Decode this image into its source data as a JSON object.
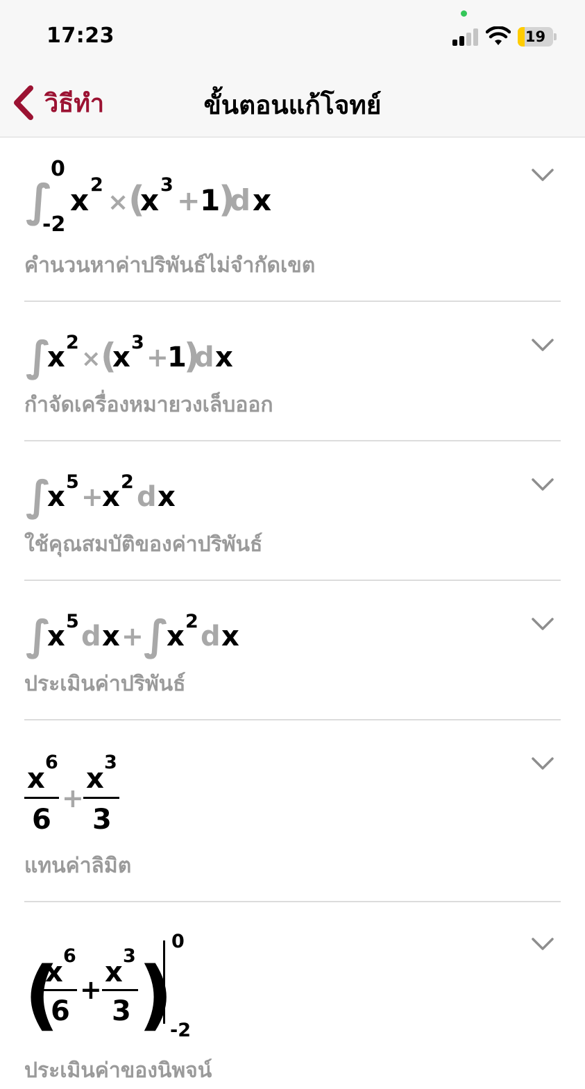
{
  "status_bar": {
    "time": "17:23",
    "battery": "19",
    "battery_level_percent": 19,
    "icons": [
      "signal-icon",
      "wifi-icon",
      "battery-icon"
    ]
  },
  "nav": {
    "back_label": "วิธีทำ",
    "title": "ขั้นตอนแก้โจทย์"
  },
  "colors": {
    "accent": "#9b1232",
    "muted_text": "#9a9a9a",
    "battery": "#ffcc00"
  },
  "steps": [
    {
      "expression": {
        "integral": "∫",
        "upper_limit": "0",
        "lower_limit": "-2",
        "x": "x",
        "exp2": "2",
        "times": "×",
        "open_paren": "(",
        "exp3": "3",
        "plus": "+",
        "one": "1",
        "close_paren": ")",
        "d": "d",
        "dx_var": "x"
      },
      "description": "คำนวนหาค่าปริพันธ์ไม่จำกัดเขต"
    },
    {
      "expression": {
        "integral": "∫",
        "x": "x",
        "exp2": "2",
        "times": "×",
        "open_paren": "(",
        "exp3": "3",
        "plus": "+",
        "one": "1",
        "close_paren": ")",
        "d": "d",
        "dx_var": "x"
      },
      "description": "กำจัดเครื่องหมายวงเล็บออก"
    },
    {
      "expression": {
        "integral": "∫",
        "x": "x",
        "exp5": "5",
        "plus": "+",
        "exp2": "2",
        "d": "d",
        "dx_var": "x"
      },
      "description": "ใช้คุณสมบัติของค่าปริพันธ์"
    },
    {
      "expression": {
        "integral": "∫",
        "x": "x",
        "exp5": "5",
        "d": "d",
        "plus": "+",
        "exp2": "2"
      },
      "description": "ประเมินค่าปริพันธ์"
    },
    {
      "expression": {
        "x": "x",
        "exp6": "6",
        "den6": "6",
        "plus": "+",
        "exp3": "3",
        "den3": "3"
      },
      "description": "แทนค่าลิมิต"
    },
    {
      "expression": {
        "open_paren": "(",
        "x": "x",
        "exp6": "6",
        "den6": "6",
        "plus": "+",
        "exp3": "3",
        "den3": "3",
        "close_paren": ")",
        "upper_limit": "0",
        "lower_limit": "-2"
      },
      "description": "ประเมินค่าของนิพจน์"
    }
  ]
}
